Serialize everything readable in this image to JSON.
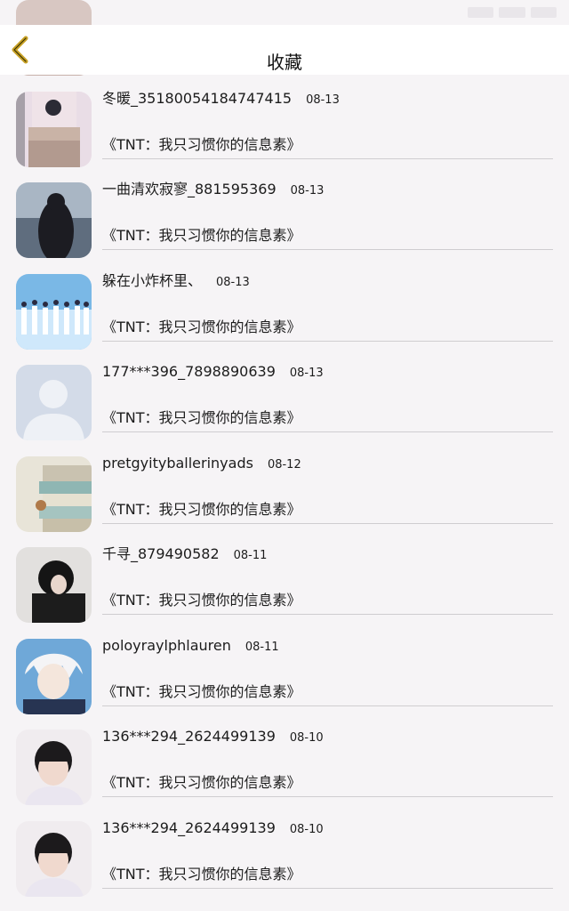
{
  "header": {
    "title": "收藏"
  },
  "items": [
    {
      "name": "",
      "date": "",
      "quote": "",
      "avatar": "a0"
    },
    {
      "name": "冬暖_35180054184747415",
      "date": "08-13",
      "quote": "《TNT：我只习惯你的信息素》",
      "avatar": "a1"
    },
    {
      "name": "一曲清欢寂寥_881595369",
      "date": "08-13",
      "quote": "《TNT：我只习惯你的信息素》",
      "avatar": "a2"
    },
    {
      "name": "躲在小炸杯里、",
      "date": "08-13",
      "quote": "《TNT：我只习惯你的信息素》",
      "avatar": "a3"
    },
    {
      "name": "177***396_7898890639",
      "date": "08-13",
      "quote": "《TNT：我只习惯你的信息素》",
      "avatar": "a4"
    },
    {
      "name": "pretgyityballerinyads",
      "date": "08-12",
      "quote": "《TNT：我只习惯你的信息素》",
      "avatar": "a5"
    },
    {
      "name": "千寻_879490582",
      "date": "08-11",
      "quote": "《TNT：我只习惯你的信息素》",
      "avatar": "a6"
    },
    {
      "name": "poloyraylphlauren",
      "date": "08-11",
      "quote": "《TNT：我只习惯你的信息素》",
      "avatar": "a7"
    },
    {
      "name": "136***294_2624499139",
      "date": "08-10",
      "quote": "《TNT：我只习惯你的信息素》",
      "avatar": "a8"
    },
    {
      "name": "136***294_2624499139",
      "date": "08-10",
      "quote": "《TNT：我只习惯你的信息素》",
      "avatar": "a8"
    }
  ],
  "colors": {
    "accent": "#c9a227",
    "text": "#1c1c1c",
    "divider": "#cfcdd0"
  }
}
